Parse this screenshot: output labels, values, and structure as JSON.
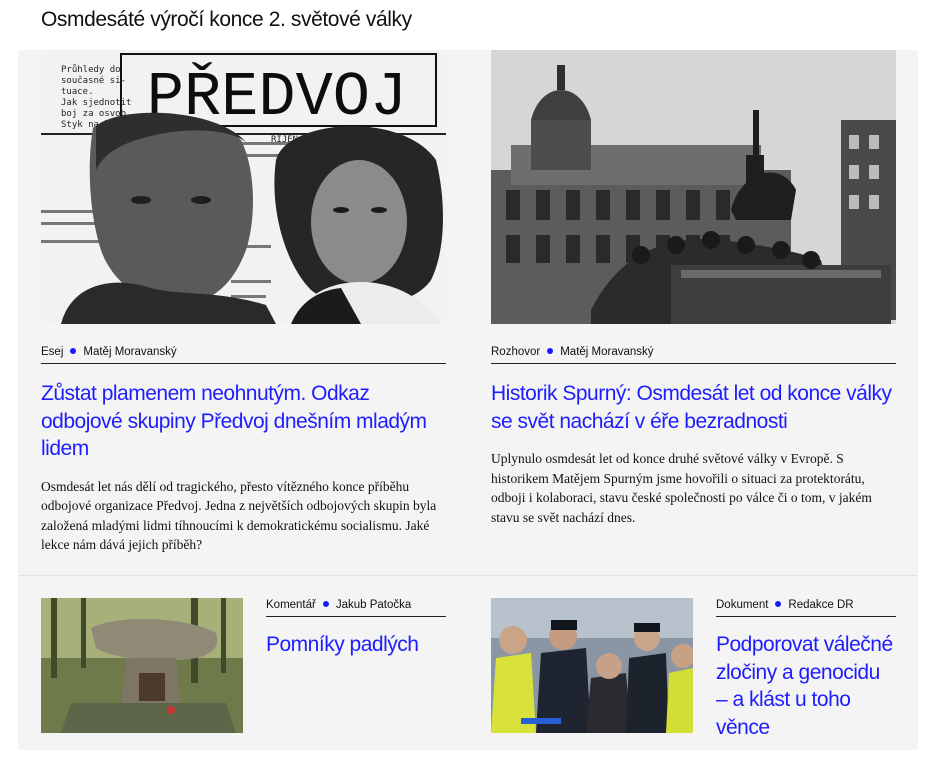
{
  "section": {
    "title": "Osmdesáté výročí konce 2. světové války"
  },
  "articles": [
    {
      "category": "Esej",
      "author": "Matěj Moravanský",
      "title": "Zůstat plamenem neohnutým. Odkaz odbojové skupiny Předvoj dnešním mladým lidem",
      "perex": "Osmdesát let nás dělí od tragického, přesto vítězného konce příběhu odbojové organizace Předvoj. Jedna z největších odbojových skupin byla založená mladými lidmi tíhnoucími k demokratickému socialismu. Jaké lekce nám dává jejich příběh?",
      "image": {
        "masthead": "PŘEDVOJ",
        "clip_lines": [
          "Průhledy do",
          "současné si-",
          "tuace.",
          "Jak sjednotit",
          "boj za osvob.",
          "Styk na heslo."
        ],
        "date_text": "ŘÍJEN 194"
      }
    },
    {
      "category": "Rozhovor",
      "author": "Matěj Moravanský",
      "title": "Historik Spurný: Osmdesát let od konce války se svět nachází v éře bezradnosti",
      "perex": "Uplynulo osmdesát let od konce druhé světové války v Evropě. S historikem Matějem Spurným jsme hovořili o situaci za protektorátu, odboji i kolaboraci, stavu české společnosti po válce či o tom, v jakém stavu se svět nachází dnes."
    },
    {
      "category": "Komentář",
      "author": "Jakub Patočka",
      "title": "Pomníky padlých"
    },
    {
      "category": "Dokument",
      "author": "Redakce DR",
      "title": "Podporovat válečné zločiny a genocidu – a klást u toho věnce"
    }
  ],
  "colors": {
    "link": "#1d1dff",
    "dot": "#1a1aff",
    "panel": "#f4f4f4"
  }
}
